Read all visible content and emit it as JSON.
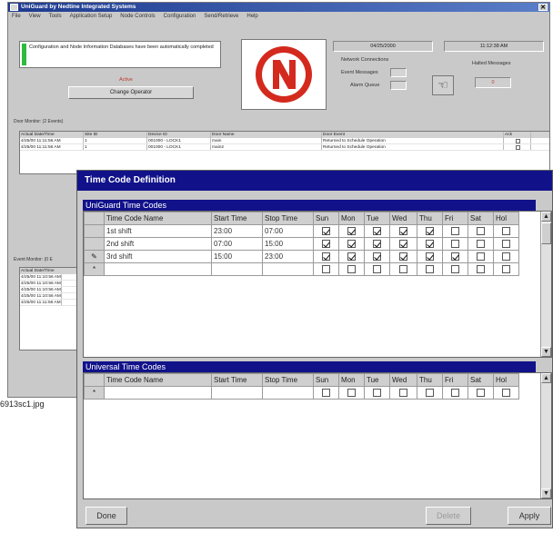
{
  "app": {
    "title": "UniGuard by Nedtine Integrated Systems",
    "menu": [
      "File",
      "View",
      "Tools",
      "Application Setup",
      "Node Controls",
      "Configuration",
      "Send/Retrieve",
      "Help"
    ],
    "message": "Configuration and Node Information Databases have been automatically completed",
    "status": "Active",
    "change_operator_label": "Change Operator",
    "date": "04/25/2000",
    "time": "11:12:38 AM",
    "network_connections_label": "Network Connections",
    "event_messages_label": "Event Messages",
    "alarm_queue_label": "Alarm Queue",
    "halted_messages_label": "Halted Messages",
    "halted_value": "0",
    "door_grid": {
      "caption": "Door Monitor: (2 Events)",
      "columns": [
        "Actual Date/Time",
        "Site ID",
        "Device ID",
        "Door Name",
        "Door Event",
        "Ack"
      ],
      "rows": [
        [
          "4/25/00 11:11:56 AM",
          "1",
          "001000 - LOCK1",
          "main",
          "Returned to Schedule Operation"
        ],
        [
          "4/25/00 11:11:56 AM",
          "1",
          "001000 - LOCK1",
          "main2",
          "Returned to Schedule Operation"
        ]
      ]
    },
    "event_panel": {
      "caption": "Event Monitor: (0 E",
      "header": "Actual Date/Time",
      "rows": [
        "4/25/00 11:10:56 AM",
        "4/25/00 11:10:56 AM",
        "4/25/00 11:10:56 AM",
        "4/25/00 11:10:56 AM",
        "4/25/00 11:11:56 AM"
      ]
    }
  },
  "dialog": {
    "title": "Time Code Definition",
    "uniguard_title": "UniGuard Time Codes",
    "universal_title": "Universal Time Codes",
    "columns": [
      "Time Code Name",
      "Start Time",
      "Stop Time",
      "Sun",
      "Mon",
      "Tue",
      "Wed",
      "Thu",
      "Fri",
      "Sat",
      "Hol"
    ],
    "uniguard_rows": [
      {
        "name": "1st shift",
        "start": "23:00",
        "stop": "07:00",
        "days": [
          true,
          true,
          true,
          true,
          true,
          false,
          false,
          false
        ]
      },
      {
        "name": "2nd shift",
        "start": "07:00",
        "stop": "15:00",
        "days": [
          true,
          true,
          true,
          true,
          true,
          false,
          false,
          false
        ]
      },
      {
        "name": "3rd shift",
        "start": "15:00",
        "stop": "23:00",
        "days": [
          true,
          true,
          true,
          true,
          true,
          true,
          false,
          false
        ]
      }
    ],
    "done_label": "Done",
    "delete_label": "Delete",
    "apply_label": "Apply"
  },
  "caption": "6913sc1.jpg"
}
